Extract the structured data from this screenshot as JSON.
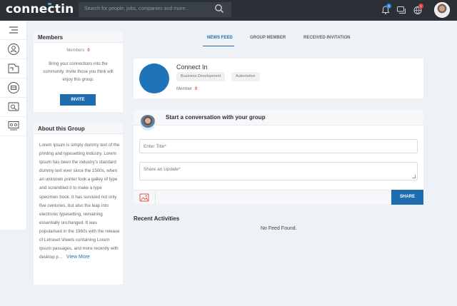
{
  "app": {
    "logo_text": "connectin",
    "search_placeholder": "Search for people, jobs, companies and more...",
    "notification_count": "1",
    "globe_count": "1",
    "brand_color": "#1f6cae"
  },
  "rail": {
    "items": [
      "menu-icon",
      "people-icon",
      "groups-icon",
      "company-icon",
      "jobs-icon",
      "events-icon"
    ]
  },
  "members_card": {
    "title": "Members",
    "count_label": "Members",
    "count": "0",
    "description": "Bring your connections into the community. Invite those you think will enjoy this group.",
    "invite_label": "INVITE"
  },
  "about_card": {
    "title": "About this Group",
    "text": "Lorem Ipsum is simply dummy text of the printing and typesetting industry. Lorem Ipsum has been the industry's standard dummy text ever since the 1500s, when an unknown printer took a galley of type and scrambled it to make a type specimen book. It has survived not only five centuries, but also the leap into electronic typesetting, remaining essentially unchanged. It was popularised in the 1960s with the release of Letraset sheets containing Lorem Ipsum passages, and more recently with desktop p...",
    "view_more": "View More"
  },
  "tabs": [
    {
      "label": "NEWS FEED",
      "active": true
    },
    {
      "label": "GROUP MEMBER",
      "active": false
    },
    {
      "label": "RECEIVED INVITATION",
      "active": false
    }
  ],
  "group": {
    "name": "Connect In",
    "tags": [
      "Business Development",
      "Automotive"
    ],
    "member_label": "Member",
    "member_count": "0"
  },
  "post": {
    "heading": "Start a conversation with your group",
    "title_placeholder": "Enter Title*",
    "update_placeholder": "Share an Update*",
    "share_label": "SHARE"
  },
  "activity": {
    "title": "Recent Activities",
    "empty_text": "No Feed Found."
  }
}
